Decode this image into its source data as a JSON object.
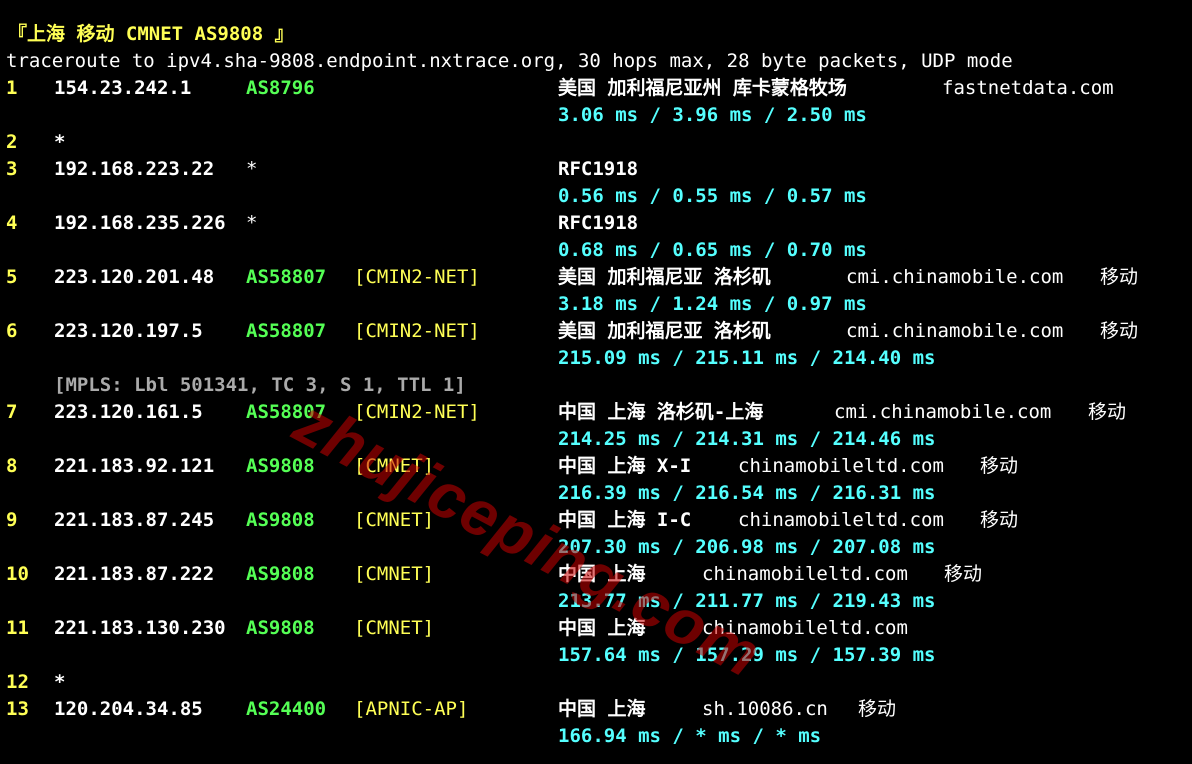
{
  "header": "『上海 移动 CMNET AS9808 』",
  "command": "traceroute to ipv4.sha-9808.endpoint.nxtrace.org, 30 hops max, 28 byte packets, UDP mode",
  "watermark": "zhujiceping.com",
  "colors": {
    "background": "#000000",
    "hop_number": "#ffff55",
    "asn": "#55ff55",
    "net_tag": "#ffff55",
    "rtt": "#55ffff",
    "mpls": "#aaaaaa",
    "watermark": "#c80000"
  },
  "hops": [
    {
      "hop": "1",
      "ip": "154.23.242.1",
      "as": "AS8796",
      "net": "",
      "loc": "美国 加利福尼亚州 库卡蒙格牧场",
      "host": "fastnetdata.com",
      "isp": "",
      "rtt": "3.06 ms / 3.96 ms / 2.50 ms"
    },
    {
      "hop": "2",
      "star": "*"
    },
    {
      "hop": "3",
      "ip": "192.168.223.22",
      "as": "*",
      "net": "",
      "loc": "RFC1918",
      "host": "",
      "isp": "",
      "rtt": "0.56 ms / 0.55 ms / 0.57 ms"
    },
    {
      "hop": "4",
      "ip": "192.168.235.226",
      "as": "*",
      "net": "",
      "loc": "RFC1918",
      "host": "",
      "isp": "",
      "rtt": "0.68 ms / 0.65 ms / 0.70 ms"
    },
    {
      "hop": "5",
      "ip": "223.120.201.48",
      "as": "AS58807",
      "net": "[CMIN2-NET]",
      "loc": "美国 加利福尼亚 洛杉矶",
      "host": "cmi.chinamobile.com",
      "isp": "移动",
      "rtt": "3.18 ms / 1.24 ms / 0.97 ms"
    },
    {
      "hop": "6",
      "ip": "223.120.197.5",
      "as": "AS58807",
      "net": "[CMIN2-NET]",
      "loc": "美国 加利福尼亚 洛杉矶",
      "host": "cmi.chinamobile.com",
      "isp": "移动",
      "rtt": "215.09 ms / 215.11 ms / 214.40 ms"
    },
    {
      "hop": "7",
      "ip": "223.120.161.5",
      "as": "AS58807",
      "net": "[CMIN2-NET]",
      "loc": "中国 上海 洛杉矶-上海",
      "host": "cmi.chinamobile.com",
      "isp": "移动",
      "rtt": "214.25 ms / 214.31 ms / 214.46 ms"
    },
    {
      "hop": "8",
      "ip": "221.183.92.121",
      "as": "AS9808",
      "net": "[CMNET]",
      "loc": "中国 上海 X-I",
      "host": "chinamobileltd.com",
      "isp": "移动",
      "rtt": "216.39 ms / 216.54 ms / 216.31 ms"
    },
    {
      "hop": "9",
      "ip": "221.183.87.245",
      "as": "AS9808",
      "net": "[CMNET]",
      "loc": "中国 上海 I-C",
      "host": "chinamobileltd.com",
      "isp": "移动",
      "rtt": "207.30 ms / 206.98 ms / 207.08 ms"
    },
    {
      "hop": "10",
      "ip": "221.183.87.222",
      "as": "AS9808",
      "net": "[CMNET]",
      "loc": "中国 上海",
      "host": "chinamobileltd.com",
      "isp": "移动",
      "rtt": "213.77 ms / 211.77 ms / 219.43 ms"
    },
    {
      "hop": "11",
      "ip": "221.183.130.230",
      "as": "AS9808",
      "net": "[CMNET]",
      "loc": "中国 上海",
      "host": "chinamobileltd.com",
      "isp": "",
      "rtt": "157.64 ms / 157.29 ms / 157.39 ms"
    },
    {
      "hop": "12",
      "star": "*"
    },
    {
      "hop": "13",
      "ip": "120.204.34.85",
      "as": "AS24400",
      "net": "[APNIC-AP]",
      "loc": "中国 上海",
      "host": "sh.10086.cn",
      "isp": "移动",
      "rtt": "166.94 ms / * ms / * ms"
    }
  ],
  "mpls": "[MPLS: Lbl 501341, TC 3, S 1, TTL 1]"
}
